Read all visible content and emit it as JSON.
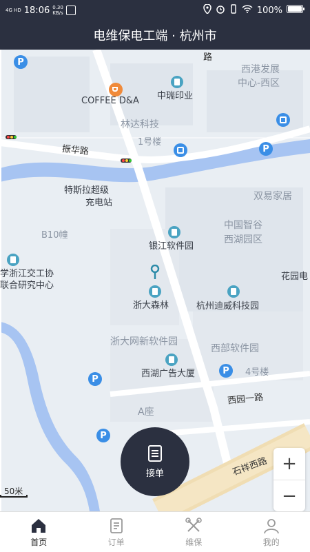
{
  "status_bar": {
    "network": "4G HD",
    "time": "18:06",
    "speed_value": "0.30",
    "speed_unit": "KB/s",
    "battery": "100%"
  },
  "header": {
    "title": "电维保电工端 · 杭州市"
  },
  "map": {
    "labels": {
      "coffee": "COFFEE D&A",
      "zhongrui": "中瑞印业",
      "linda": "林达科技",
      "building1": "1号楼",
      "xigang1": "西港发展",
      "xigang2": "中心-西区",
      "zhenhua_road": "振华路",
      "tesla1": "特斯拉超级",
      "tesla2": "充电站",
      "shuangyi": "双易家居",
      "zhongguo1": "中国智谷",
      "zhongguo2": "西湖园区",
      "b10": "B10幢",
      "yinjiang": "银江软件园",
      "jiaogong1": "学浙江交工协",
      "jiaogong2": "联合研究中心",
      "zheda_forest": "浙大森林",
      "hangzhou_diwei": "杭州迪威科技园",
      "huayuan": "花园电",
      "zheda_software": "浙大网新软件园",
      "xibu_software": "西部软件园",
      "xihu_ad": "西湖广告大厦",
      "building4": "4号楼",
      "xiyuan_road": "西园一路",
      "a_block": "A座",
      "shixiang_road": "石祥西路",
      "lu": "路"
    },
    "scale_label": "50米",
    "colors": {
      "river": "#a7c4f2",
      "road": "#ffffff",
      "block": "#dfe5ec",
      "water_accent": "#3a8ee6"
    }
  },
  "fab": {
    "label": "接单",
    "icon": "document-icon"
  },
  "zoom": {
    "in": "+",
    "out": "−"
  },
  "tabs": [
    {
      "label": "首页",
      "icon": "home-icon",
      "active": true
    },
    {
      "label": "订单",
      "icon": "order-list-icon",
      "active": false
    },
    {
      "label": "维保",
      "icon": "tools-icon",
      "active": false
    },
    {
      "label": "我的",
      "icon": "profile-icon",
      "active": false
    }
  ]
}
